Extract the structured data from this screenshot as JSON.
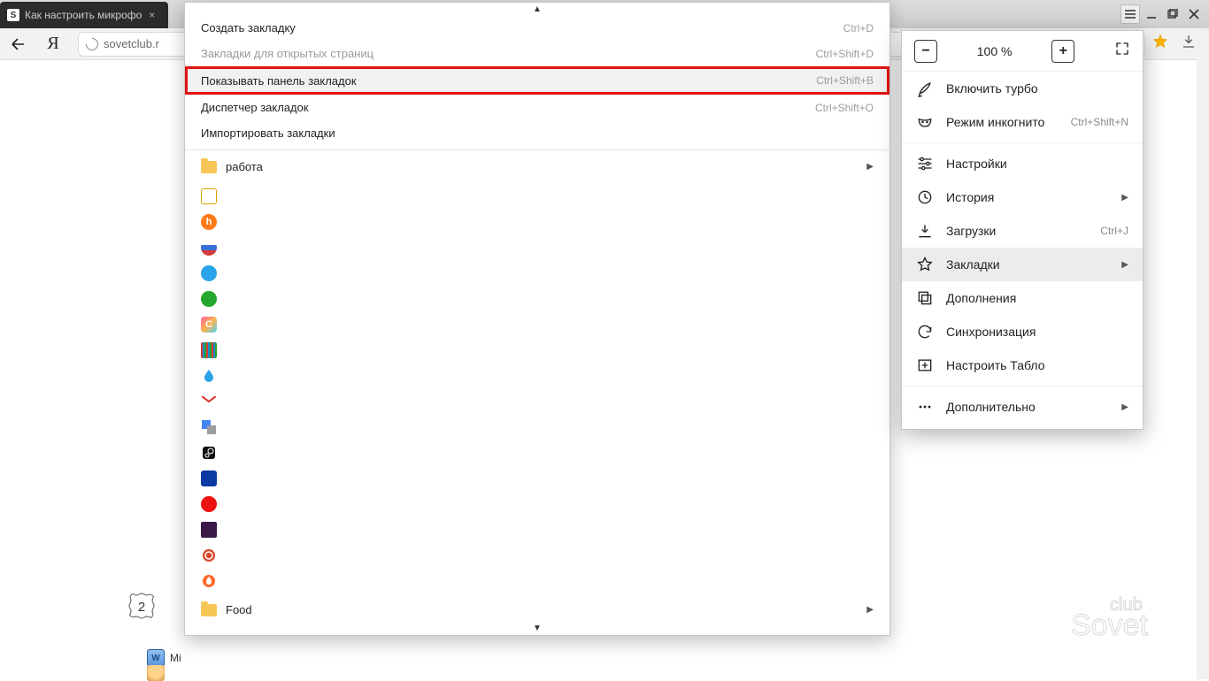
{
  "tab": {
    "title": "Как настроить микрофо",
    "favicon_letter": "S"
  },
  "address": {
    "url_display": "sovetclub.r"
  },
  "zoom": {
    "value": "100 %"
  },
  "main_menu": {
    "turbo": "Включить турбо",
    "incognito": "Режим инкогнито",
    "incognito_shortcut": "Ctrl+Shift+N",
    "settings": "Настройки",
    "history": "История",
    "downloads": "Загрузки",
    "downloads_shortcut": "Ctrl+J",
    "bookmarks": "Закладки",
    "addons": "Дополнения",
    "sync": "Синхронизация",
    "tablo": "Настроить Табло",
    "more": "Дополнительно"
  },
  "bm_menu": {
    "create": "Создать закладку",
    "create_sc": "Ctrl+D",
    "open_tabs": "Закладки для открытых страниц",
    "open_tabs_sc": "Ctrl+Shift+D",
    "show_bar": "Показывать панель закладок",
    "show_bar_sc": "Ctrl+Shift+B",
    "manager": "Диспетчер закладок",
    "manager_sc": "Ctrl+Shift+O",
    "import": "Импортировать закладки",
    "folder1": "работа",
    "folder2": "Food"
  },
  "favicons": [
    {
      "bg": "#fff",
      "fg": "#d9a400",
      "txt": "",
      "radius": "3px",
      "border": "1px solid #d9a400"
    },
    {
      "bg": "#ff7a1a",
      "fg": "#fff",
      "txt": "h",
      "radius": "50%"
    },
    {
      "bg": "linear-gradient(#fff 0 33%,#3a6fd8 33% 66%,#d43a3a 66%)",
      "fg": "",
      "txt": "",
      "radius": "50%"
    },
    {
      "bg": "#2aa3e8",
      "fg": "#fff",
      "txt": "",
      "radius": "50%"
    },
    {
      "bg": "#25a72d",
      "fg": "#fff",
      "txt": "",
      "radius": "50%"
    },
    {
      "bg": "linear-gradient(135deg,#ff5fa2,#ffb24d,#4dd2ff)",
      "fg": "#fff",
      "txt": "C",
      "radius": "4px"
    },
    {
      "bg": "repeating-linear-gradient(90deg,#d43a3a 0 2px,#28c 2px 4px,#2a2 4px 6px)",
      "fg": "",
      "txt": "",
      "radius": "2px"
    },
    {
      "bg": "#fff",
      "fg": "#2aa3e8",
      "txt": "",
      "radius": "0",
      "extra": "drop"
    },
    {
      "bg": "#fff",
      "fg": "#d93025",
      "txt": "M",
      "radius": "0",
      "extra": "gmail"
    },
    {
      "bg": "#4285f4",
      "fg": "#fff",
      "txt": "",
      "radius": "2px",
      "extra": "translate"
    },
    {
      "bg": "#111",
      "fg": "#fff",
      "txt": "",
      "radius": "3px",
      "extra": "steam"
    },
    {
      "bg": "#0b3aa2",
      "fg": "#3cf",
      "txt": "",
      "radius": "3px"
    },
    {
      "bg": "#e11",
      "fg": "#fff",
      "txt": "",
      "radius": "50%"
    },
    {
      "bg": "#3a1848",
      "fg": "#eac",
      "txt": "",
      "radius": "2px"
    },
    {
      "bg": "#d9462a",
      "fg": "#fff",
      "txt": "",
      "radius": "50%",
      "extra": "ring"
    },
    {
      "bg": "#ff6a2a",
      "fg": "#fff",
      "txt": "",
      "radius": "50%",
      "extra": "flame"
    }
  ],
  "step_badge": "2",
  "taskbar": {
    "word_label": "Mi"
  },
  "watermark": "Sovet club"
}
